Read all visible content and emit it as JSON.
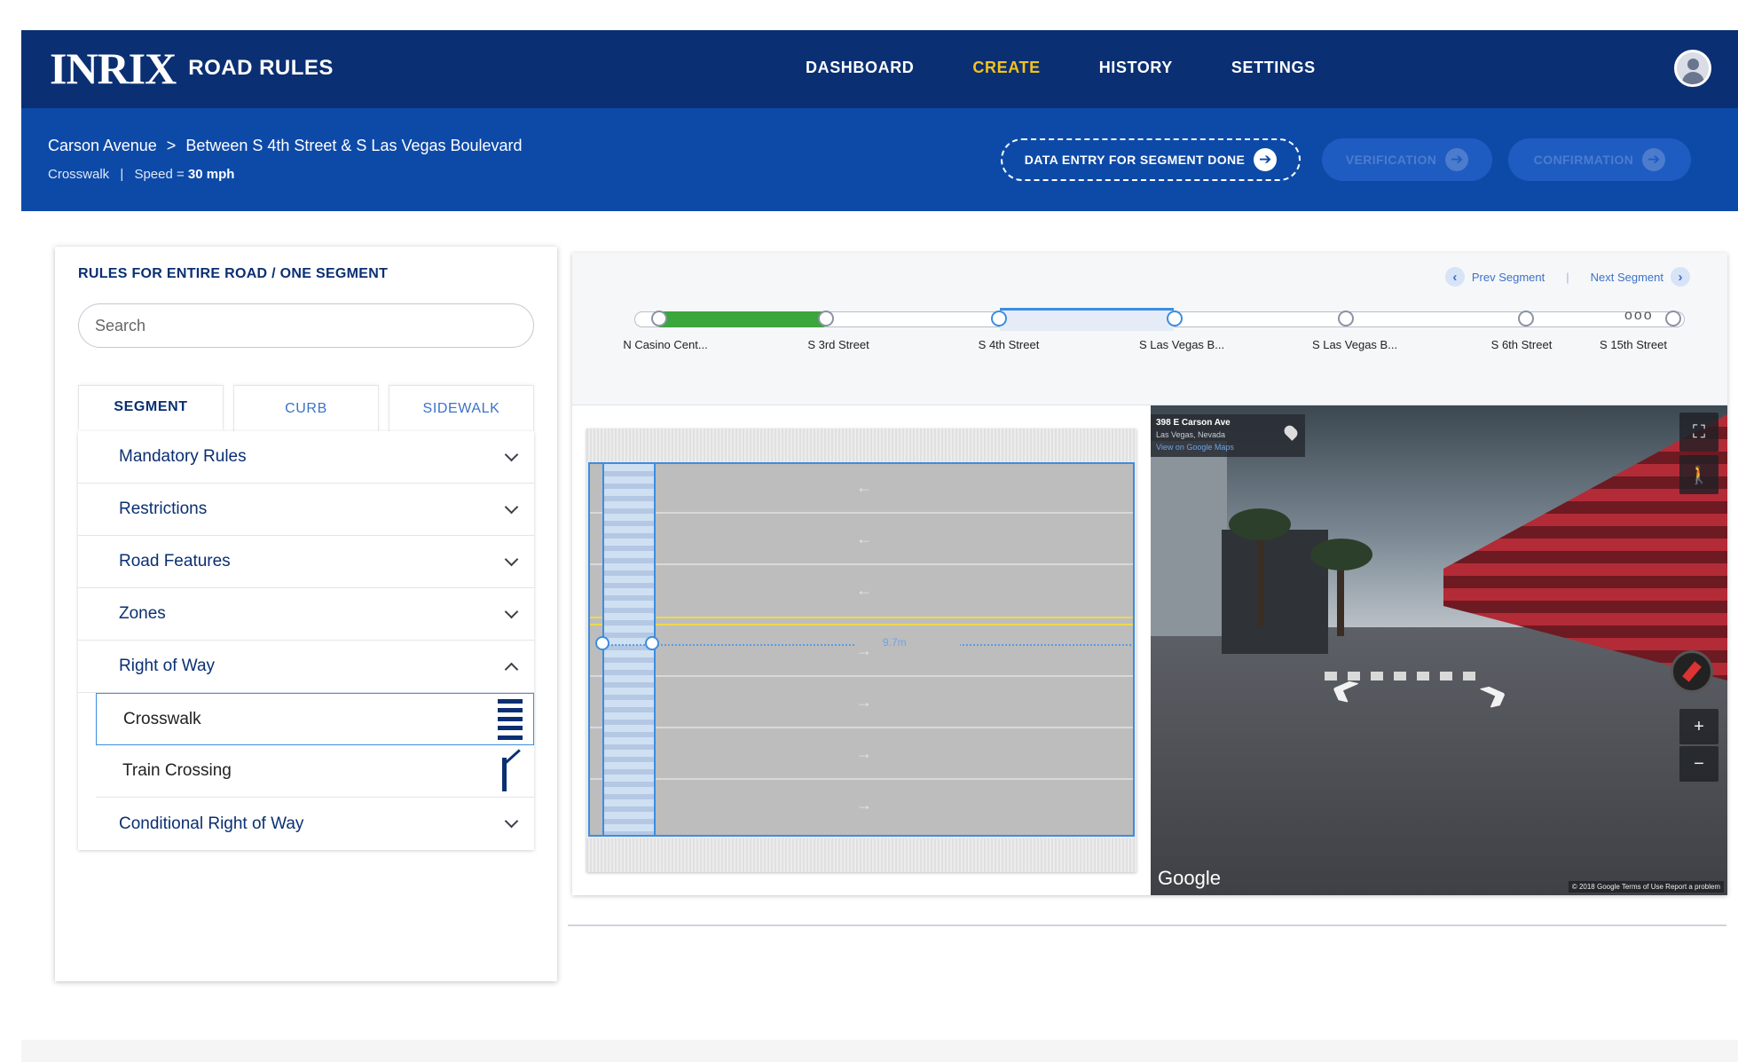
{
  "app": {
    "logo": "INRIX",
    "product": "ROAD RULES"
  },
  "nav": {
    "items": [
      {
        "label": "DASHBOARD",
        "active": false
      },
      {
        "label": "CREATE",
        "active": true
      },
      {
        "label": "HISTORY",
        "active": false
      },
      {
        "label": "SETTINGS",
        "active": false
      }
    ],
    "active_color": "#f4c21b"
  },
  "subheader": {
    "road": "Carson Avenue",
    "separator": ">",
    "segment": "Between S 4th Street & S Las Vegas Boulevard",
    "type": "Crosswalk",
    "divider": "|",
    "speed_label": "Speed = ",
    "speed_value": "30 mph",
    "steps": {
      "data_entry": "DATA ENTRY FOR SEGMENT DONE",
      "verification": "VERIFICATION",
      "confirmation": "CONFIRMATION"
    }
  },
  "left_panel": {
    "title": "RULES FOR ENTIRE ROAD / ONE SEGMENT",
    "search_placeholder": "Search",
    "tabs": [
      {
        "label": "SEGMENT",
        "active": true
      },
      {
        "label": "CURB",
        "active": false
      },
      {
        "label": "SIDEWALK",
        "active": false
      }
    ],
    "sections": [
      {
        "label": "Mandatory Rules",
        "expanded": false
      },
      {
        "label": "Restrictions",
        "expanded": false
      },
      {
        "label": "Road Features",
        "expanded": false
      },
      {
        "label": "Zones",
        "expanded": false
      },
      {
        "label": "Right of Way",
        "expanded": true
      },
      {
        "label": "Conditional Right of Way",
        "expanded": false
      }
    ],
    "right_of_way_items": [
      {
        "label": "Crosswalk",
        "icon": "crosswalk-icon",
        "selected": true
      },
      {
        "label": "Train Crossing",
        "icon": "train-crossing-icon",
        "selected": false
      }
    ]
  },
  "segment_bar": {
    "prev": "Prev Segment",
    "next": "Next Segment",
    "nav_divider": "|",
    "ellipsis": "ooo",
    "segments": [
      "N Casino Cent...",
      "S 3rd Street",
      "S 4th Street",
      "S Las Vegas B...",
      "S Las Vegas B...",
      "S 6th Street",
      "S 15th Street"
    ],
    "completed_color": "#3aa63c"
  },
  "road_diagram": {
    "lanes": [
      "west",
      "west",
      "west",
      "east",
      "east",
      "east",
      "east"
    ],
    "lane_arrows": {
      "west": "←",
      "east": "→"
    },
    "measure_label": "9.7m"
  },
  "street_view": {
    "address": "398 E Carson Ave",
    "city": "Las Vegas, Nevada",
    "maps_link": "View on Google Maps",
    "brand": "Google",
    "legal": "© 2018 Google   Terms of Use   Report a problem",
    "fullscreen_icon": "⛶",
    "zoom_in": "+",
    "zoom_out": "−"
  }
}
